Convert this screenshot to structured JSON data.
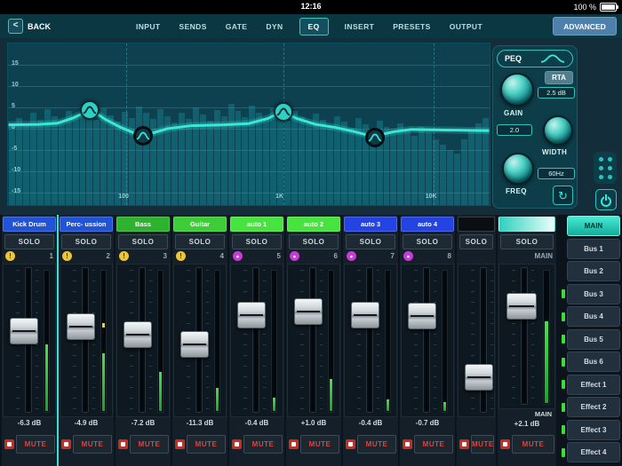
{
  "status_bar": {
    "time": "12:16",
    "battery_pct": "100 %"
  },
  "nav": {
    "back_label": "BACK",
    "tabs": [
      "INPUT",
      "SENDS",
      "GATE",
      "DYN",
      "EQ",
      "INSERT",
      "PRESETS",
      "OUTPUT"
    ],
    "active_tab": "EQ",
    "advanced_label": "ADVANCED"
  },
  "eq": {
    "y_ticks": [
      "15",
      "10",
      "5",
      "0",
      "-5",
      "-10",
      "-15"
    ],
    "x_ticks": [
      {
        "label": "100",
        "pct": 24.5
      },
      {
        "label": "1K",
        "pct": 57
      },
      {
        "label": "10K",
        "pct": 88
      }
    ],
    "spectrum": [
      92,
      98,
      90,
      104,
      96,
      108,
      100,
      94,
      106,
      98,
      112,
      103,
      96,
      109,
      101,
      94,
      105,
      98,
      111,
      104,
      97,
      108,
      100,
      93,
      104,
      97,
      110,
      102,
      95,
      107,
      100,
      114,
      106,
      99,
      112,
      104,
      97,
      109,
      102,
      95,
      106,
      99,
      92,
      103,
      96,
      89,
      100,
      94,
      87,
      98,
      91,
      84,
      95,
      88,
      81,
      92,
      85,
      78,
      88,
      82,
      74,
      68,
      62,
      58,
      74,
      84,
      92,
      98
    ],
    "curve_points": [
      [
        0,
        0.7
      ],
      [
        6,
        0.8
      ],
      [
        10,
        1.1
      ],
      [
        13,
        2.2
      ],
      [
        17,
        4.3
      ],
      [
        20,
        2.0
      ],
      [
        23,
        0.2
      ],
      [
        26,
        -1.2
      ],
      [
        28,
        -1.7
      ],
      [
        30,
        -1.2
      ],
      [
        33,
        -0.2
      ],
      [
        38,
        0.5
      ],
      [
        45,
        0.7
      ],
      [
        50,
        1.0
      ],
      [
        54,
        2.2
      ],
      [
        57,
        3.9
      ],
      [
        60,
        2.2
      ],
      [
        64,
        0.8
      ],
      [
        68,
        0.1
      ],
      [
        72,
        -0.9
      ],
      [
        76,
        -2.1
      ],
      [
        80,
        -1.0
      ],
      [
        84,
        -0.4
      ],
      [
        90,
        -0.5
      ],
      [
        95,
        -0.6
      ],
      [
        100,
        -0.7
      ]
    ],
    "nodes": [
      {
        "x_pct": 17,
        "db": 4.3,
        "variant": "filled"
      },
      {
        "x_pct": 28,
        "db": -1.7,
        "variant": "outline"
      },
      {
        "x_pct": 57,
        "db": 3.9,
        "variant": "filled"
      },
      {
        "x_pct": 76,
        "db": -2.1,
        "variant": "outline"
      }
    ],
    "panel": {
      "title": "PEQ",
      "rta_label": "RTA",
      "gain_label": "GAIN",
      "gain_value": "2.5 dB",
      "q_value": "2.0",
      "width_label": "WIDTH",
      "freq_label": "FREQ",
      "freq_value": "60Hz"
    }
  },
  "labels": {
    "solo": "SOLO",
    "mute": "MUTE"
  },
  "channels": [
    {
      "name": "Kick Drum",
      "color": "#2153d6",
      "badge": "warning",
      "number": "1",
      "fader_pct": 42,
      "meter_pct": 46,
      "db": "-6.3 dB",
      "selected": true
    },
    {
      "name": "Perc- ussion",
      "color": "#2153d6",
      "badge": "warning",
      "number": "2",
      "fader_pct": 39,
      "meter_pct": 40,
      "peak_pct": 36,
      "db": "-4.9 dB"
    },
    {
      "name": "Bass",
      "color": "#2eb32e",
      "badge": "warning",
      "number": "3",
      "fader_pct": 45,
      "meter_pct": 27,
      "db": "-7.2 dB"
    },
    {
      "name": "Guitar",
      "color": "#3ecd38",
      "badge": "warning",
      "number": "4",
      "fader_pct": 53,
      "meter_pct": 16,
      "db": "-11.3 dB"
    },
    {
      "name": "auto 1",
      "color": "#47e33e",
      "badge": "link",
      "number": "5",
      "fader_pct": 29,
      "meter_pct": 9,
      "db": "-0.4 dB"
    },
    {
      "name": "auto 2",
      "color": "#47e33e",
      "badge": "link",
      "number": "6",
      "fader_pct": 26,
      "meter_pct": 22,
      "db": "+1.0 dB"
    },
    {
      "name": "auto 3",
      "color": "#2343e2",
      "badge": "link",
      "number": "7",
      "fader_pct": 29,
      "meter_pct": 8,
      "db": "-0.4 dB"
    },
    {
      "name": "auto 4",
      "color": "#2343e2",
      "badge": "link",
      "number": "8",
      "fader_pct": 30,
      "meter_pct": 6,
      "db": "-0.7 dB"
    },
    {
      "name": "",
      "color": "#0a0f14",
      "badge": "none",
      "number": "",
      "fader_pct": 80,
      "meter_pct": 0,
      "db": "",
      "clipped": true
    }
  ],
  "master": {
    "solo": "SOLO",
    "top_right_label": "MAIN",
    "bottom_label": "MAIN",
    "db": "+2.1 dB",
    "mute": "MUTE",
    "fader_pct": 23,
    "meter_pct": 60
  },
  "sidebar": [
    {
      "label": "MAIN",
      "active": true,
      "tick": false
    },
    {
      "label": "Bus 1",
      "tick": false
    },
    {
      "label": "Bus 2",
      "tick": false
    },
    {
      "label": "Bus 3",
      "tick": true
    },
    {
      "label": "Bus 4",
      "tick": true
    },
    {
      "label": "Bus 5",
      "tick": true
    },
    {
      "label": "Bus 6",
      "tick": true
    },
    {
      "label": "Effect 1",
      "tick": true
    },
    {
      "label": "Effect 2",
      "tick": true
    },
    {
      "label": "Effect 3",
      "tick": true
    },
    {
      "label": "Effect 4",
      "tick": true
    }
  ]
}
